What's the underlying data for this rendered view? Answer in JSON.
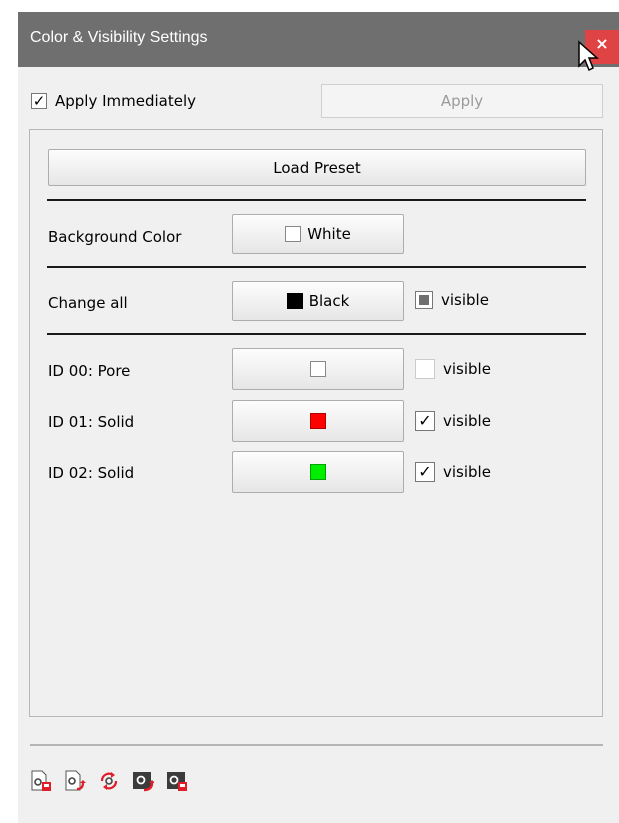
{
  "window": {
    "title": "Color & Visibility Settings",
    "close_label": "×"
  },
  "top": {
    "apply_immediately_label": "Apply Immediately",
    "apply_immediately_checked": true,
    "apply_label": "Apply"
  },
  "panel": {
    "load_preset_label": "Load Preset",
    "background": {
      "label": "Background Color",
      "color_name": "White",
      "color": "#ffffff"
    },
    "change_all": {
      "label": "Change all",
      "color_name": "Black",
      "color": "#000000",
      "visible_label": "visible",
      "visible_state": "indeterminate"
    },
    "ids": [
      {
        "label": "ID 00: Pore",
        "color": "#ffffff",
        "visible_label": "visible",
        "visible": false
      },
      {
        "label": "ID 01: Solid",
        "color": "#ff0000",
        "visible_label": "visible",
        "visible": true
      },
      {
        "label": "ID 02: Solid",
        "color": "#00ee00",
        "visible_label": "visible",
        "visible": true
      }
    ]
  },
  "toolbar": {
    "icons": [
      "save-settings-icon",
      "load-settings-icon",
      "reset-settings-icon",
      "import-settings-icon",
      "export-settings-icon"
    ]
  },
  "colors": {
    "title_bar": "#6f6f6f",
    "close_button": "#e04343",
    "icon_red": "#e21d2a"
  },
  "check_mark": "✓"
}
